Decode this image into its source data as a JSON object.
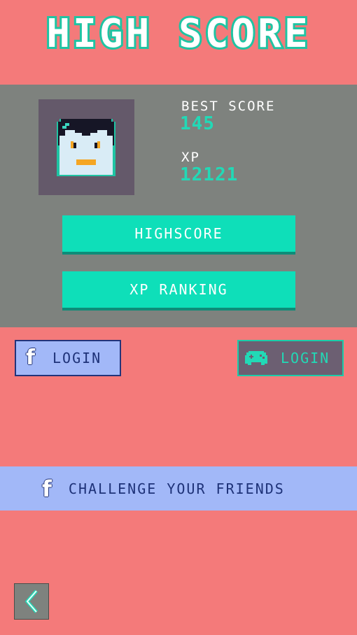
{
  "title": "HIGH SCORE",
  "profile": {
    "best_score_label": "BEST SCORE",
    "best_score_value": "145",
    "xp_label": "XP",
    "xp_value": "12121"
  },
  "buttons": {
    "highscore": "HIGHSCORE",
    "xp_ranking": "XP RANKING"
  },
  "login": {
    "facebook_label": "LOGIN",
    "facebook_icon": "f",
    "gamepad_label": "LOGIN"
  },
  "challenge": {
    "icon": "f",
    "label": "CHALLENGE YOUR FRIENDS"
  },
  "colors": {
    "background": "#F47A7A",
    "panel": "#7E827E",
    "accent_teal": "#0EDFB9",
    "facebook_blue": "#A2B8F8"
  }
}
